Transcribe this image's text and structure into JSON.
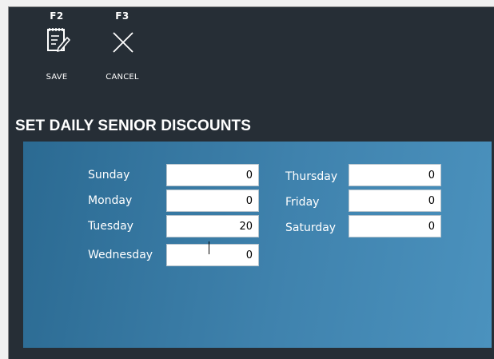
{
  "toolbar": {
    "save": {
      "key": "F2",
      "label": "SAVE",
      "icon": "edit-note-icon"
    },
    "cancel": {
      "key": "F3",
      "label": "CANCEL",
      "icon": "close-icon"
    }
  },
  "page_title": "SET DAILY SENIOR DISCOUNTS",
  "days": {
    "sunday": {
      "label": "Sunday",
      "value": "0"
    },
    "monday": {
      "label": "Monday",
      "value": "0"
    },
    "tuesday": {
      "label": "Tuesday",
      "value": "20"
    },
    "wednesday": {
      "label": "Wednesday",
      "value": "0"
    },
    "thursday": {
      "label": "Thursday",
      "value": "0"
    },
    "friday": {
      "label": "Friday",
      "value": "0"
    },
    "saturday": {
      "label": "Saturday",
      "value": "0"
    }
  },
  "colors": {
    "window_bg": "#262e36",
    "panel_bg": "#3f82ad",
    "text": "#ffffff"
  }
}
